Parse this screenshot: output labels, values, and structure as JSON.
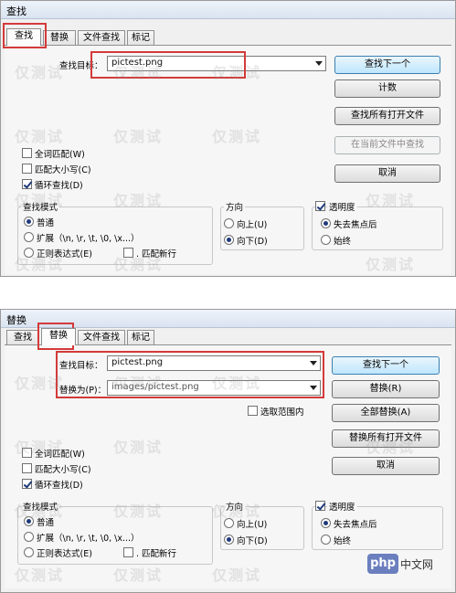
{
  "watermark": "仅测试",
  "php_badge": {
    "logo": "php",
    "text": "中文网"
  },
  "find_dialog": {
    "title": "查找",
    "tabs": [
      "查找",
      "替换",
      "文件查找",
      "标记"
    ],
    "find_label": "查找目标：",
    "find_value": "pictest.png",
    "buttons": {
      "find_next": "查找下一个",
      "count": "计数",
      "find_all_open": "查找所有打开文件",
      "find_all_current": "在当前文件中查找",
      "cancel": "取消"
    },
    "options": {
      "whole_word": "全词匹配(W)",
      "match_case": "匹配大小写(C)",
      "wrap": "循环查找(D)"
    },
    "search_mode": {
      "title": "查找模式",
      "normal": "普通",
      "extended": "扩展（\\n, \\r, \\t, \\0, \\x...）",
      "regex": "正则表达式(E)",
      "newline": ". 匹配新行"
    },
    "direction": {
      "title": "方向",
      "up": "向上(U)",
      "down": "向下(D)"
    },
    "transparency": {
      "title": "透明度",
      "on_lose_focus": "失去焦点后",
      "always": "始终"
    }
  },
  "replace_dialog": {
    "title": "替换",
    "tabs": [
      "查找",
      "替换",
      "文件查找",
      "标记"
    ],
    "find_label": "查找目标：",
    "find_value": "pictest.png",
    "replace_label": "替换为(P)：",
    "replace_value": "images/pictest.png",
    "in_selection": "选取范围内",
    "buttons": {
      "find_next": "查找下一个",
      "replace": "替换(R)",
      "replace_all": "全部替换(A)",
      "replace_all_open": "替换所有打开文件",
      "cancel": "取消"
    },
    "options": {
      "whole_word": "全词匹配(W)",
      "match_case": "匹配大小写(C)",
      "wrap": "循环查找(D)"
    },
    "search_mode": {
      "title": "查找模式",
      "normal": "普通",
      "extended": "扩展（\\n, \\r, \\t, \\0, \\x...）",
      "regex": "正则表达式(E)",
      "newline": ". 匹配新行"
    },
    "direction": {
      "title": "方向",
      "up": "向上(U)",
      "down": "向下(D)"
    },
    "transparency": {
      "title": "透明度",
      "on_lose_focus": "失去焦点后",
      "always": "始终"
    }
  }
}
